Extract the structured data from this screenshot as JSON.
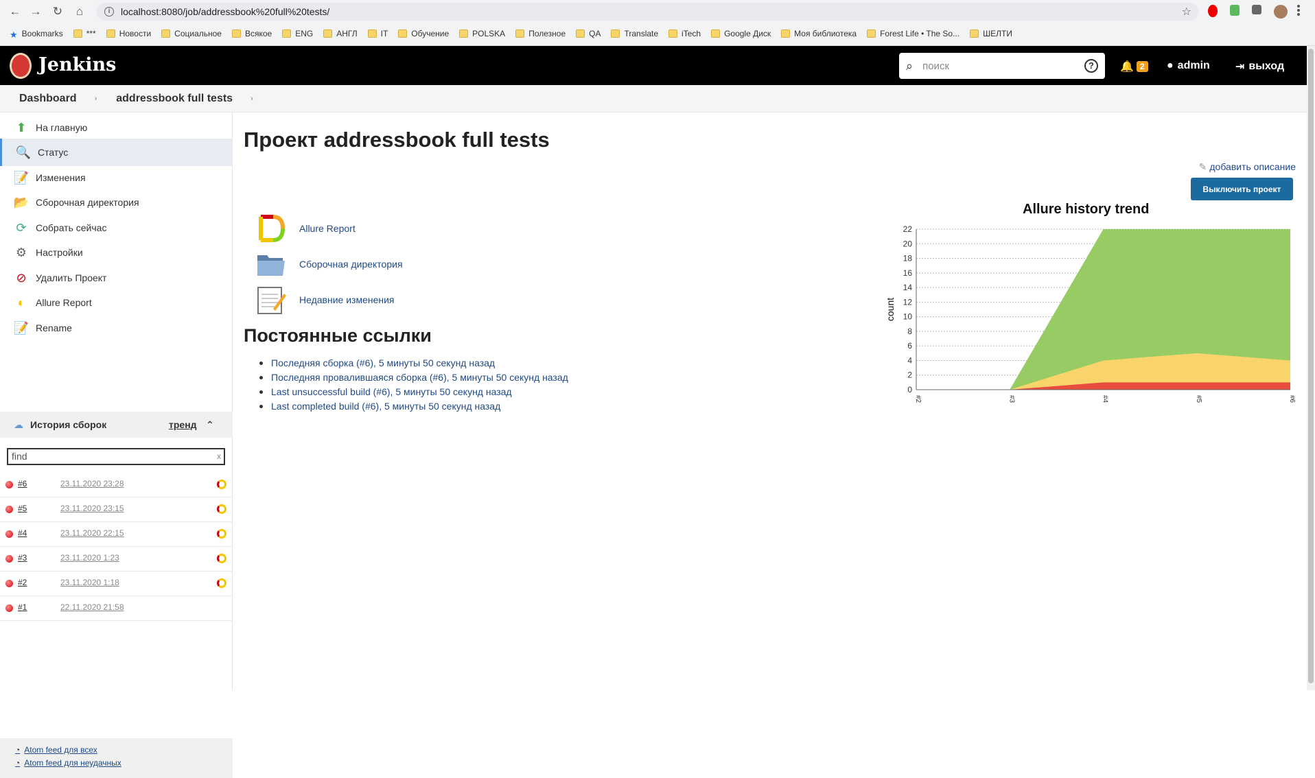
{
  "browser": {
    "url": "localhost:8080/job/addressbook%20full%20tests/",
    "bookmarks": [
      "Bookmarks",
      "***",
      "Новости",
      "Социальное",
      "Всякое",
      "ENG",
      "АНГЛ",
      "IT",
      "Обучение",
      "POLSKA",
      "Полезное",
      "QA",
      "Translate",
      "iTech",
      "Google Диск",
      "Моя библиотека",
      "Forest Life • The So...",
      "ШЕЛТИ"
    ]
  },
  "header": {
    "logo_text": "Jenkins",
    "search_placeholder": "поиск",
    "notifications_count": "2",
    "user": "admin",
    "logout": "выход"
  },
  "breadcrumb": [
    "Dashboard",
    "addressbook full tests"
  ],
  "sidebar": {
    "tasks": [
      {
        "label": "На главную",
        "icon": "arrow-up-icon"
      },
      {
        "label": "Статус",
        "icon": "magnifier-icon"
      },
      {
        "label": "Изменения",
        "icon": "notepad-icon"
      },
      {
        "label": "Сборочная директория",
        "icon": "folder-icon"
      },
      {
        "label": "Собрать сейчас",
        "icon": "clock-play-icon"
      },
      {
        "label": "Настройки",
        "icon": "gear-icon"
      },
      {
        "label": "Удалить Проект",
        "icon": "no-entry-icon"
      },
      {
        "label": "Allure Report",
        "icon": "allure-icon"
      },
      {
        "label": "Rename",
        "icon": "notepad-icon"
      }
    ],
    "history_title": "История сборок",
    "trend_link": "тренд",
    "find_placeholder": "find",
    "find_clear": "x",
    "builds": [
      {
        "num": "#6",
        "date": "23.11.2020 23:28"
      },
      {
        "num": "#5",
        "date": "23.11.2020 23:15"
      },
      {
        "num": "#4",
        "date": "23.11.2020 22:15"
      },
      {
        "num": "#3",
        "date": "23.11.2020 1:23"
      },
      {
        "num": "#2",
        "date": "23.11.2020 1:18"
      },
      {
        "num": "#1",
        "date": "22.11.2020 21:58"
      }
    ],
    "feeds": [
      "Atom feed для всех",
      "Atom feed для неудачных"
    ]
  },
  "main": {
    "title": "Проект addressbook full tests",
    "add_description": "добавить описание",
    "disable_button": "Выключить проект",
    "links": [
      "Allure Report",
      "Сборочная директория",
      "Недавние изменения"
    ],
    "permalinks_title": "Постоянные ссылки",
    "permalinks": [
      "Последняя сборка (#6), 5 минуты 50 секунд назад",
      "Последняя провалившаяся сборка (#6), 5 минуты 50 секунд назад",
      "Last unsuccessful build (#6), 5 минуты 50 секунд назад",
      "Last completed build (#6), 5 минуты 50 секунд назад"
    ]
  },
  "chart_data": {
    "type": "area",
    "title": "Allure history trend",
    "ylabel": "count",
    "xlabel": "",
    "x": [
      "#2",
      "#3",
      "#4",
      "#5",
      "#6"
    ],
    "ylim": [
      0,
      22
    ],
    "yticks": [
      0,
      2,
      4,
      6,
      8,
      10,
      12,
      14,
      16,
      18,
      20,
      22
    ],
    "series": [
      {
        "color": "#e74c3c",
        "values": [
          0,
          0,
          1,
          1,
          1
        ]
      },
      {
        "color": "#f9d46b",
        "values": [
          0,
          0,
          3,
          4,
          3
        ]
      },
      {
        "color": "#97cc64",
        "values": [
          0,
          0,
          18,
          17,
          18
        ]
      }
    ]
  }
}
